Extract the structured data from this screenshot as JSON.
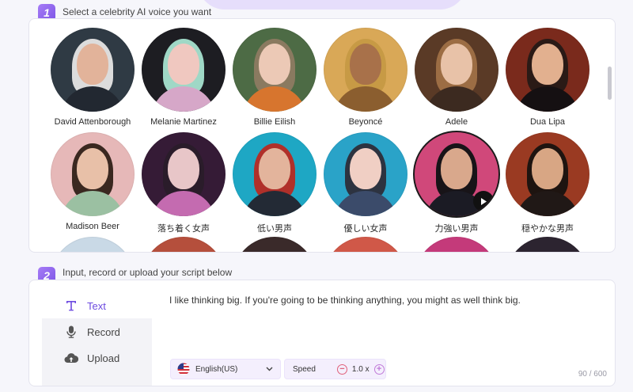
{
  "steps": [
    {
      "number": "1",
      "title": "Select a celebrity AI voice you want"
    },
    {
      "number": "2",
      "title": "Input, record or upload your script below"
    }
  ],
  "voices_row1": [
    {
      "name": "David Attenborough",
      "hair": "#dcdcdc",
      "skin": "#e2b39a",
      "bg": "#2f3a44",
      "cloth": "#222831"
    },
    {
      "name": "Melanie Martinez",
      "hair": "#9fd8c6",
      "skin": "#f0c8c0",
      "bg": "#1d1d22",
      "cloth": "#d6a7c8"
    },
    {
      "name": "Billie Eilish",
      "hair": "#8a7a60",
      "skin": "#ecc9b6",
      "bg": "#4d6b45",
      "cloth": "#d7752e"
    },
    {
      "name": "Beyoncé",
      "hair": "#c79a45",
      "skin": "#a8714a",
      "bg": "#d9a857",
      "cloth": "#8b5e2f"
    },
    {
      "name": "Adele",
      "hair": "#9c6d44",
      "skin": "#e8c2a8",
      "bg": "#5a3a26",
      "cloth": "#3c2a20"
    },
    {
      "name": "Dua Lipa",
      "hair": "#2a1a16",
      "skin": "#e2b08f",
      "bg": "#7a2a1c",
      "cloth": "#151012"
    }
  ],
  "voices_row2": [
    {
      "name": "Madison Beer",
      "hair": "#3a2820",
      "skin": "#e8c0a8",
      "bg": "#e6b8b8",
      "cloth": "#9bc0a2"
    },
    {
      "name": "落ち着く女声",
      "hair": "#2a1c2a",
      "skin": "#e8c6c8",
      "bg": "#351b36",
      "cloth": "#c46bb0"
    },
    {
      "name": "低い男声",
      "hair": "#b0302a",
      "skin": "#e3b49c",
      "bg": "#1ea7c4",
      "cloth": "#232a35"
    },
    {
      "name": "優しい女声",
      "hair": "#2d3340",
      "skin": "#f0cfc4",
      "bg": "#2aa3c8",
      "cloth": "#3b4b6a"
    },
    {
      "name": "力強い男声",
      "hair": "#181418",
      "skin": "#d9a88c",
      "bg": "#d0487a",
      "cloth": "#1b1b24"
    },
    {
      "name": "穏やかな男声",
      "hair": "#1e1410",
      "skin": "#d8a684",
      "bg": "#9a3a22",
      "cloth": "#201816"
    }
  ],
  "voices_row3_colors": [
    "#c9d9e6",
    "#b54f3c",
    "#3a2a2a",
    "#d05848",
    "#c43a7a",
    "#2c2430"
  ],
  "selected_voice": "力強い男声",
  "tabs": [
    {
      "label": "Text",
      "icon": "text-icon",
      "active": true
    },
    {
      "label": "Record",
      "icon": "microphone-icon",
      "active": false
    },
    {
      "label": "Upload",
      "icon": "cloud-upload-icon",
      "active": false
    }
  ],
  "script": {
    "text": "I like thinking big. If you're going to be thinking anything, you might as well think big.",
    "char_count": "90 / 600"
  },
  "language": {
    "value": "English(US)",
    "flag_icon": "us-flag-icon"
  },
  "speed": {
    "label": "Speed",
    "value": "1.0 x"
  },
  "colors": {
    "accent": "#7c55e6",
    "active_tab_text": "#6d4be0"
  }
}
